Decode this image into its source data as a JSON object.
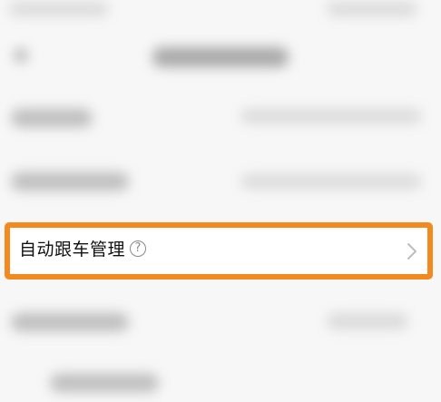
{
  "row": {
    "label": "自动跟车管理",
    "help_glyph": "?",
    "chevron": "chevron-right-icon"
  },
  "colors": {
    "highlight": "#f28a1f",
    "background": "#f7f7f7",
    "row_background": "#ffffff"
  }
}
